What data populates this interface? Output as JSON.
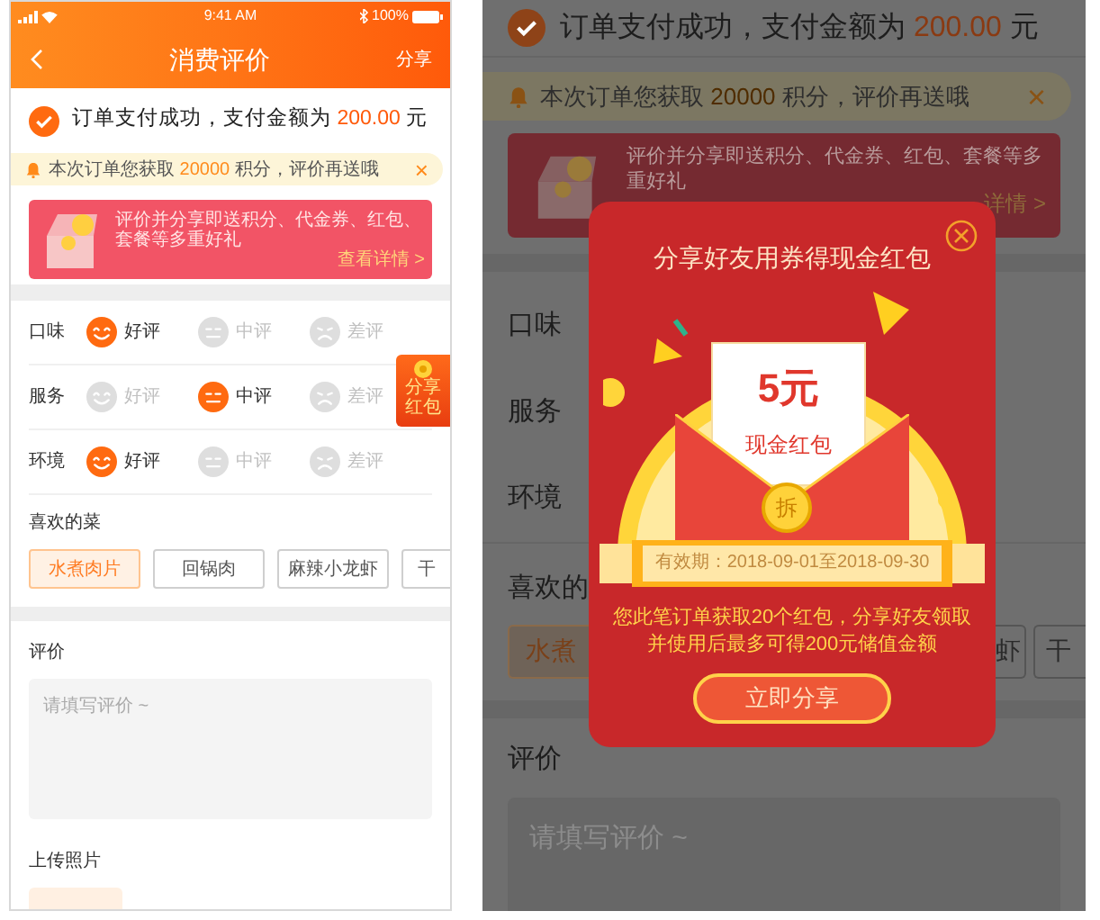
{
  "left_screen": {
    "status_bar": {
      "time": "9:41 AM",
      "battery": "100%"
    },
    "nav": {
      "title": "消费评价",
      "action": "分享"
    },
    "payment": {
      "prefix": "订单支付成功，支付金额为 ",
      "amount": "200.00",
      "suffix": " 元"
    },
    "notice": {
      "prefix": "本次订单您获取 ",
      "points": "20000",
      "suffix": " 积分，评价再送哦",
      "close": "×"
    },
    "promo": {
      "text": "评价并分享即送积分、代金券、红包、套餐等多重好礼",
      "link": "查看详情 >"
    },
    "ratings": [
      {
        "label": "口味",
        "options": [
          {
            "kind": "good",
            "label": "好评",
            "selected": true
          },
          {
            "kind": "neutral",
            "label": "中评",
            "selected": false
          },
          {
            "kind": "bad",
            "label": "差评",
            "selected": false
          }
        ]
      },
      {
        "label": "服务",
        "options": [
          {
            "kind": "good",
            "label": "好评",
            "selected": false
          },
          {
            "kind": "neutral",
            "label": "中评",
            "selected": true
          },
          {
            "kind": "bad",
            "label": "差评",
            "selected": false
          }
        ]
      },
      {
        "label": "环境",
        "options": [
          {
            "kind": "good",
            "label": "好评",
            "selected": true
          },
          {
            "kind": "neutral",
            "label": "中评",
            "selected": false
          },
          {
            "kind": "bad",
            "label": "差评",
            "selected": false
          }
        ]
      }
    ],
    "float_badge": "分享红包",
    "dishes": {
      "title": "喜欢的菜",
      "tags": [
        {
          "label": "水煮肉片",
          "selected": true
        },
        {
          "label": "回锅肉",
          "selected": false
        },
        {
          "label": "麻辣小龙虾",
          "selected": false
        },
        {
          "label": "干",
          "selected": false
        }
      ]
    },
    "review": {
      "title": "评价",
      "placeholder": "请填写评价 ~"
    },
    "upload": {
      "title": "上传照片"
    }
  },
  "right_screen": {
    "payment": {
      "prefix": "订单支付成功，支付金额为 ",
      "amount": "200.00",
      "suffix": " 元"
    },
    "notice": {
      "prefix": "本次订单您获取 ",
      "points": "20000",
      "suffix": " 积分，评价再送哦",
      "close": "×"
    },
    "promo": {
      "text": "评价并分享即送积分、代金券、红包、套餐等多重好礼",
      "link": "详情 >"
    },
    "ratings": [
      {
        "label": "口味"
      },
      {
        "label": "服务"
      },
      {
        "label": "环境"
      }
    ],
    "dishes": {
      "title": "喜欢的",
      "tags": [
        {
          "label": "水煮",
          "selected": true
        },
        {
          "label": "虾",
          "selected": false
        },
        {
          "label": "干",
          "selected": false
        }
      ]
    },
    "review": {
      "title": "评价",
      "placeholder": "请填写评价 ~"
    },
    "modal": {
      "title": "分享好友用券得现金红包",
      "amount": "5元",
      "envelope_label": "现金红包",
      "coin": "拆",
      "validity": "有效期：2018-09-01至2018-09-30",
      "description": "您此笔订单获取20个红包，分享好友领取并使用后最多可得200元储值金额",
      "button": "立即分享"
    }
  }
}
